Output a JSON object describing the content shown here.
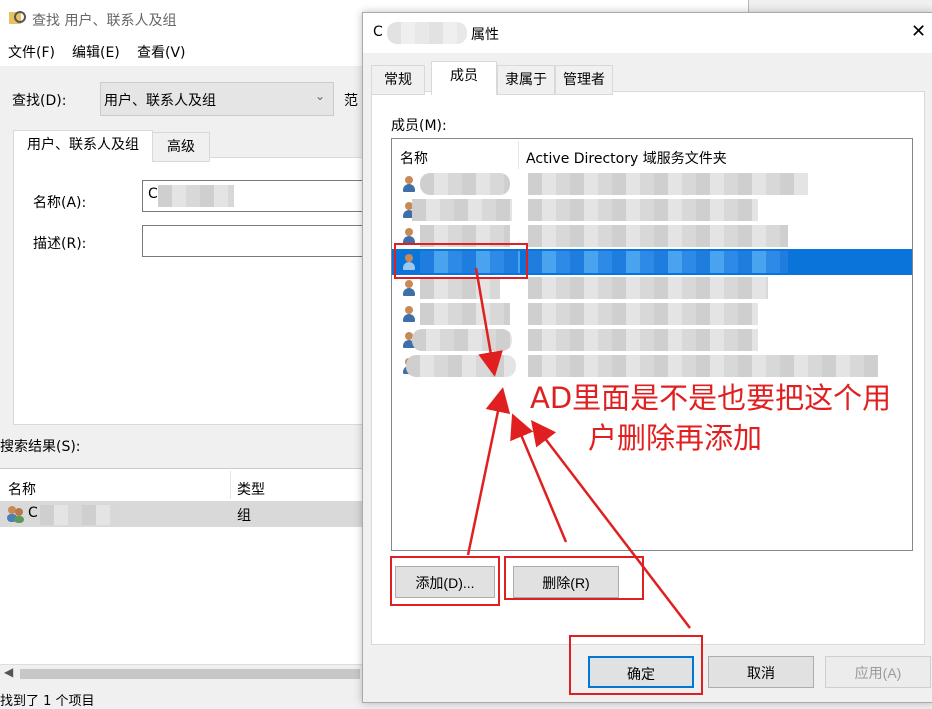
{
  "find_window": {
    "title": "查找 用户、联系人及组",
    "menu": [
      "文件(F)",
      "编辑(E)",
      "查看(V)"
    ],
    "find_label": "查找(D):",
    "find_value": "用户、联系人及组",
    "scope_label": "范",
    "tabs": [
      "用户、联系人及组",
      "高级"
    ],
    "name_label": "名称(A):",
    "name_value": "C",
    "desc_label": "描述(R):",
    "results_label": "搜索结果(S):",
    "col_name": "名称",
    "col_type": "类型",
    "result_row": {
      "name": "C",
      "type": "组"
    },
    "status": "找到了 1 个项目"
  },
  "props_dialog": {
    "title_prefix": "C",
    "title_suffix": "属性",
    "tabs": [
      "常规",
      "成员",
      "隶属于",
      "管理者"
    ],
    "members_label": "成员(M):",
    "col_name": "名称",
    "col_folder": "Active Directory 域服务文件夹",
    "add_button": "添加(D)...",
    "remove_button": "删除(R)",
    "ok_button": "确定",
    "cancel_button": "取消",
    "apply_button": "应用(A)"
  },
  "annotation": {
    "line1": "AD里面是不是也要把这个用",
    "line2": "户删除再添加"
  }
}
